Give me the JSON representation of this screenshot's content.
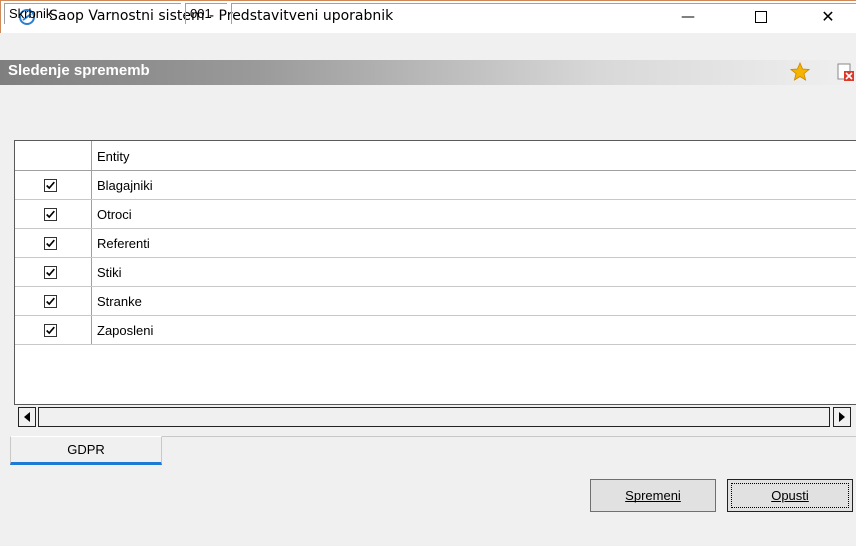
{
  "window": {
    "title": "Saop Varnostni sistem - Predstavitveni uporabnik",
    "minimize_glyph": "—",
    "close_glyph": "✕"
  },
  "header": {
    "title": "Sledenje sprememb",
    "icons": [
      "star-icon",
      "close-document-icon"
    ]
  },
  "grid": {
    "columns": [
      "",
      "Entity"
    ],
    "rows": [
      {
        "checked": true,
        "entity": "Blagajniki"
      },
      {
        "checked": true,
        "entity": "Otroci"
      },
      {
        "checked": true,
        "entity": "Referenti"
      },
      {
        "checked": true,
        "entity": "Stiki"
      },
      {
        "checked": true,
        "entity": "Stranke"
      },
      {
        "checked": true,
        "entity": "Zaposleni"
      }
    ]
  },
  "tabs": [
    {
      "label": "GDPR",
      "active": true
    }
  ],
  "buttons": {
    "spremeni": "Spremeni",
    "opusti": "Opusti"
  },
  "status": {
    "role": "Skrbnik",
    "code": "001",
    "empty": ""
  },
  "colors": {
    "accent_tab": "#1e78d6",
    "star": "#f5b400"
  }
}
